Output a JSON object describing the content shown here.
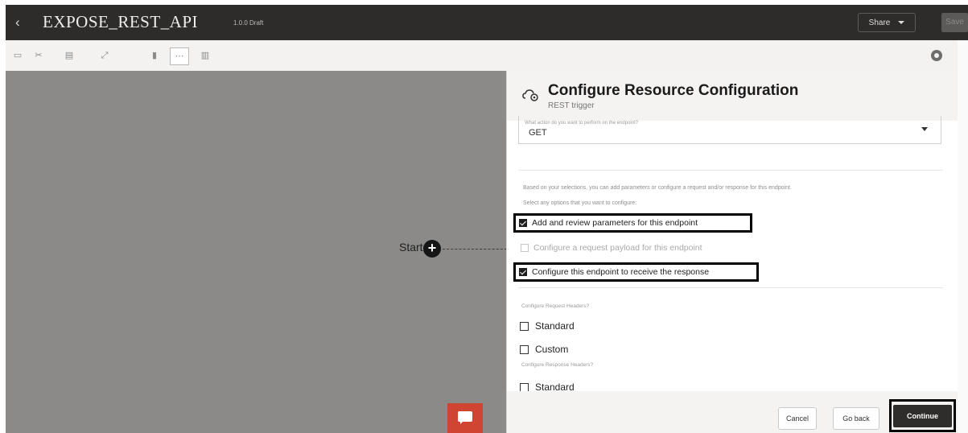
{
  "header": {
    "back_glyph": "‹",
    "title": "EXPOSE_REST_API",
    "status": "1.0.0 Draft",
    "share_label": "Share",
    "action_label": "Save"
  },
  "toolbar": {
    "icons": [
      "cut-icon",
      "copy-icon",
      "paste-icon",
      "expand-icon",
      "vertical-layout-icon",
      "horizontal-layout-icon",
      "panel-layout-icon",
      "settings-icon"
    ]
  },
  "canvas": {
    "start_label": "Start",
    "start_plus": "+"
  },
  "panel": {
    "title": "Configure Resource Configuration",
    "subtitle": "REST trigger",
    "method_hint": "What action do you want to perform on the endpoint?",
    "method_value": "GET",
    "help_text_1": "Based on your selections, you can add parameters or configure a request and/or response for this endpoint.",
    "help_text_2": "Select any options that you want to configure:",
    "options": [
      {
        "label": "Add and review parameters for this endpoint",
        "checked": true
      },
      {
        "label": "Configure a request payload for this endpoint",
        "checked": false
      },
      {
        "label": "Configure this endpoint to receive the response",
        "checked": true
      }
    ],
    "request_headers_label": "Configure Request Headers?",
    "request_headers": [
      {
        "label": "Standard",
        "checked": false
      },
      {
        "label": "Custom",
        "checked": false
      }
    ],
    "response_headers_label": "Configure Response Headers?",
    "response_headers": [
      {
        "label": "Standard",
        "checked": false
      }
    ],
    "buttons": {
      "cancel": "Cancel",
      "go_back": "Go back",
      "continue": "Continue"
    }
  },
  "colors": {
    "header_bg": "#2d2c2a",
    "canvas_bg": "#8b8a89",
    "chat_button": "#cf4532",
    "continue_bg": "#2f2d2b"
  }
}
